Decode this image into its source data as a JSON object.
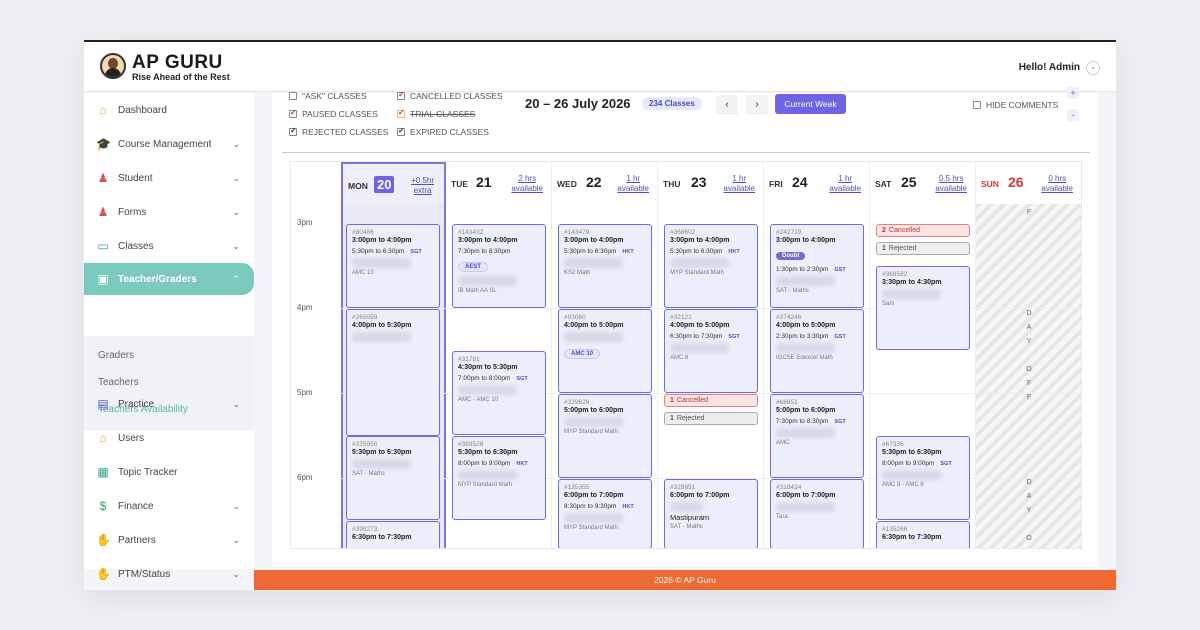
{
  "header": {
    "brand": "AP GURU",
    "tagline": "Rise Ahead of the Rest",
    "greeting": "Hello! Admin"
  },
  "sidebar": {
    "items": [
      {
        "label": "Dashboard",
        "icon": "home-icon"
      },
      {
        "label": "Course Management",
        "icon": "graduation-cap-icon"
      },
      {
        "label": "Student",
        "icon": "student-icon"
      },
      {
        "label": "Forms",
        "icon": "forms-icon"
      },
      {
        "label": "Classes",
        "icon": "classes-icon"
      },
      {
        "label": "Teacher/Graders",
        "icon": "teacher-icon"
      },
      {
        "label": "Practice",
        "icon": "clipboard-icon"
      },
      {
        "label": "Users",
        "icon": "users-icon"
      },
      {
        "label": "Topic Tracker",
        "icon": "table-icon"
      },
      {
        "label": "Finance",
        "icon": "money-bag-icon"
      },
      {
        "label": "Partners",
        "icon": "handshake-icon"
      },
      {
        "label": "PTM/Status",
        "icon": "meeting-icon"
      }
    ],
    "sub_items": [
      "Graders",
      "Teachers",
      "Teachers Availability"
    ]
  },
  "filters": {
    "ask": "\"ASK\" CLASSES",
    "paused": "PAUSED CLASSES",
    "rejected": "REJECTED CLASSES",
    "cancelled": "CANCELLED CLASSES",
    "trial": "TRIAL CLASSES",
    "expired": "EXPIRED CLASSES",
    "hide_comments": "HIDE COMMENTS"
  },
  "toolbar": {
    "range": "20 – 26 July 2026",
    "count": "234 Classes",
    "prev": "‹",
    "next": "›",
    "current_week": "Current Week",
    "zoom_in": "+",
    "zoom_out": "-"
  },
  "days": [
    {
      "name": "MON",
      "num": "20",
      "avail1": "+0.5hr",
      "avail2": "extra"
    },
    {
      "name": "TUE",
      "num": "21",
      "avail1": "2 hrs",
      "avail2": "available"
    },
    {
      "name": "WED",
      "num": "22",
      "avail1": "1 hr",
      "avail2": "available"
    },
    {
      "name": "THU",
      "num": "23",
      "avail1": "1 hr",
      "avail2": "available"
    },
    {
      "name": "FRI",
      "num": "24",
      "avail1": "1 hr",
      "avail2": "available"
    },
    {
      "name": "SAT",
      "num": "25",
      "avail1": "0.5 hrs",
      "avail2": "available"
    },
    {
      "name": "SUN",
      "num": "26",
      "avail1": "0 hrs",
      "avail2": "available"
    }
  ],
  "hours": [
    "3pm",
    "4pm",
    "5pm",
    "6pm"
  ],
  "events": {
    "mon": [
      {
        "id": "#80486",
        "time": "3:00pm to 4:00pm",
        "local": "5:30pm to 6:30pm",
        "tz": "SGT",
        "course": "AMC 10"
      },
      {
        "id": "#265059",
        "time": "4:00pm to 5:30pm"
      },
      {
        "id": "#325950",
        "time": "5:30pm to 6:30pm",
        "course": "SAT - Maths"
      },
      {
        "id": "#399273",
        "time": "6:30pm to 7:30pm"
      }
    ],
    "tue": [
      {
        "id": "#143432",
        "time": "3:00pm to 4:00pm",
        "local": "7:30pm to 8:30pm",
        "tag": "AEST",
        "course": "IB Math AA SL"
      },
      {
        "id": "#31781",
        "time": "4:30pm to 5:30pm",
        "local": "7:00pm to 8:00pm",
        "tz": "SGT",
        "course": "AMC - AMC 10"
      },
      {
        "id": "#369528",
        "time": "5:30pm to 6:30pm",
        "local": "8:00pm to 9:00pm",
        "tz": "HKT",
        "course": "MYP Standard Math"
      }
    ],
    "wed": [
      {
        "id": "#143479",
        "time": "3:00pm to 4:00pm",
        "local": "5:30pm to 6:30pm",
        "tz": "HKT",
        "course": "KS2 Math"
      },
      {
        "id": "#93060",
        "time": "4:00pm to 5:00pm",
        "tag": "AMC 10"
      },
      {
        "id": "#329628",
        "time": "5:00pm to 6:00pm",
        "course": "MYP Standard Math"
      },
      {
        "id": "#135355",
        "time": "6:00pm to 7:00pm",
        "local": "8:30pm to 9:30pm",
        "tz": "HKT",
        "course": "MYP Standard Math"
      }
    ],
    "thu": [
      {
        "id": "#368602",
        "time": "3:00pm to 4:00pm",
        "local": "5:30pm to 6:30pm",
        "tz": "HKT",
        "course": "MYP Standard Math"
      },
      {
        "id": "#32121",
        "time": "4:00pm to 5:00pm",
        "local": "6:30pm to 7:30pm",
        "tz": "SGT",
        "course": "AMC 8"
      },
      {
        "id": "#328651",
        "time": "6:00pm to 7:00pm",
        "name": "Mastipuram",
        "course": "SAT - Maths"
      }
    ],
    "fri": [
      {
        "id": "#242719",
        "time": "3:00pm to 4:00pm",
        "tag": "Doubt",
        "local": "1:30pm to 2:30pm",
        "tz": "GST",
        "course": "SAT - Maths"
      },
      {
        "id": "#374246",
        "time": "4:00pm to 5:00pm",
        "local": "2:30pm to 3:30pm",
        "tz": "GST",
        "course": "IGCSE Edexcel Math"
      },
      {
        "id": "#66851",
        "time": "5:00pm to 6:00pm",
        "local": "7:30pm to 8:30pm",
        "tz": "SGT",
        "course": "AMC"
      },
      {
        "id": "#318424",
        "time": "6:00pm to 7:00pm",
        "course": "Tara"
      }
    ],
    "sat": [
      {
        "id": "#369582",
        "time": "3:30pm to 4:30pm",
        "course": "Sam"
      },
      {
        "id": "#67336",
        "time": "5:30pm to 6:30pm",
        "local": "8:00pm to 9:00pm",
        "tz": "SGT",
        "course": "AMC 8 - AMC 8"
      },
      {
        "id": "#135266",
        "time": "6:30pm to 7:30pm"
      }
    ]
  },
  "statuses": {
    "cancelled": "Cancelled",
    "rejected": "Rejected",
    "count": "1",
    "count2": "2"
  },
  "day_off": [
    "D",
    "A",
    "Y",
    "O",
    "F",
    "F"
  ],
  "footer": "2026 © AP Guru",
  "colors": {
    "accent": "#6f63e8",
    "teal": "#7cc9c0",
    "footer": "#ee6a32",
    "sunday": "#d9363e"
  }
}
